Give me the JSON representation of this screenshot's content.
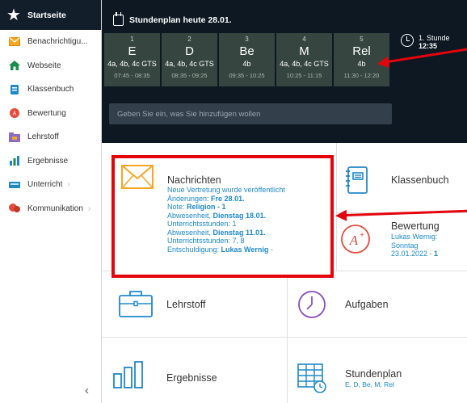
{
  "sidebar": {
    "home_label": "Startseite",
    "items": [
      {
        "label": "Benachrichtigu...",
        "icon": "envelope-icon",
        "chevron": false
      },
      {
        "label": "Webseite",
        "icon": "house-icon",
        "chevron": false
      },
      {
        "label": "Klassenbuch",
        "icon": "book-icon",
        "chevron": false
      },
      {
        "label": "Bewertung",
        "icon": "grade-icon",
        "chevron": false
      },
      {
        "label": "Lehrstoff",
        "icon": "folder-icon",
        "chevron": false
      },
      {
        "label": "Ergebnisse",
        "icon": "bar-chart-icon",
        "chevron": false
      },
      {
        "label": "Unterricht",
        "icon": "classroom-icon",
        "chevron": true
      },
      {
        "label": "Kommunikation",
        "icon": "chat-icon",
        "chevron": true
      }
    ],
    "collapse_glyph": "‹"
  },
  "header": {
    "title": "Stundenplan heute 28.01.",
    "periods": [
      {
        "num": "1",
        "subject": "E",
        "classes": "4a, 4b, 4c GTS",
        "time": "07:45 - 08:35"
      },
      {
        "num": "2",
        "subject": "D",
        "classes": "4a, 4b, 4c GTS",
        "time": "08:35 - 09:25"
      },
      {
        "num": "3",
        "subject": "Be",
        "classes": "4b",
        "time": "09:35 - 10:25"
      },
      {
        "num": "4",
        "subject": "M",
        "classes": "4a, 4b, 4c GTS",
        "time": "10:25 - 11:15"
      },
      {
        "num": "5",
        "subject": "Rel",
        "classes": "4b",
        "time": "11:30 - 12:20"
      }
    ],
    "next_label": "1. Stunde",
    "next_time": "12:35",
    "input_placeholder": "Geben Sie ein, was Sie hinzufügen wollen"
  },
  "tiles": {
    "nachrichten": {
      "title": "Nachrichten",
      "l1": "Neue Vertretung wurde veröffentlicht",
      "l2a": "Änderungen: ",
      "l2b": "Fre 28.01.",
      "l3a": "Note: ",
      "l3b": "Religion - 1",
      "l4a": "Abwesenheit, ",
      "l4b": "Dienstag 18.01.",
      "l5": "Unterrichtsstunden: 1",
      "l6a": "Abwesenheit, ",
      "l6b": "Dienstag 11.01.",
      "l7": "Unterrichtsstunden: 7, 8",
      "l8a": "Entschuldigung: ",
      "l8b": "Lukas Wernig",
      "l8c": " -"
    },
    "klassenbuch": {
      "title": "Klassenbuch"
    },
    "bewertung": {
      "title": "Bewertung",
      "d1": "Lukas Wernig:",
      "d2": "Sonntag",
      "d3a": "23.01.2022 - ",
      "d3b": "1"
    },
    "lehrstoff": {
      "title": "Lehrstoff"
    },
    "aufgaben": {
      "title": "Aufgaben"
    },
    "ergebnisse": {
      "title": "Ergebnisse"
    },
    "stundenplan": {
      "title": "Stundenplan",
      "sub": "E, D, Be, M, Rel"
    }
  },
  "colors": {
    "accent": "#1e88c8",
    "highlight": "#e4040c",
    "header_bg": "#0d1822",
    "period_bg": "#36453f"
  }
}
